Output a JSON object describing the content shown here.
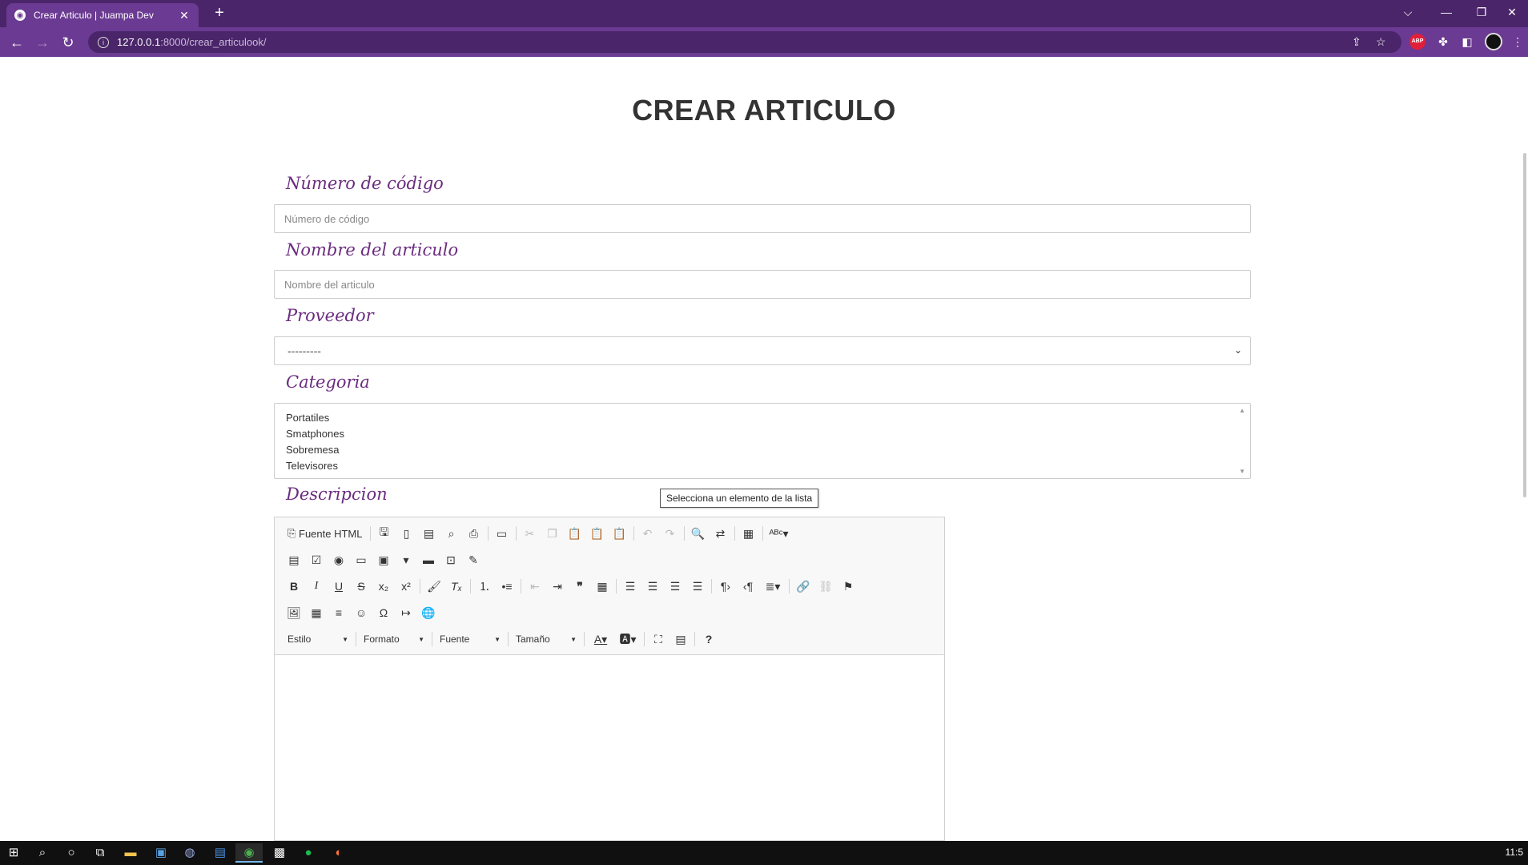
{
  "browser": {
    "tab_title": "Crear Articulo | Juampa Dev",
    "tab_close": "✕",
    "new_tab": "+",
    "url_host": "127.0.0.1",
    "url_path": ":8000/crear_articulook/",
    "window_controls": [
      "⌵",
      "—",
      "❐",
      "✕"
    ],
    "extensions": [
      "share-icon",
      "star-icon",
      "adblock-icon",
      "puzzle-icon",
      "sidepanel-icon",
      "avatar",
      "kebab-icon"
    ],
    "abp_label": "ABP"
  },
  "page": {
    "title": "CREAR ARTICULO",
    "fields": {
      "codigo_label": "Número de código",
      "codigo_placeholder": "Número de código",
      "nombre_label": "Nombre del articulo",
      "nombre_placeholder": "Nombre del articulo",
      "proveedor_label": "Proveedor",
      "proveedor_value": "---------",
      "categoria_label": "Categoria",
      "categoria_options": [
        "Portatiles",
        "Smatphones",
        "Sobremesa",
        "Televisores"
      ],
      "descripcion_label": "Descripcion"
    },
    "tooltip": "Selecciona un elemento de la lista"
  },
  "editor": {
    "source_label": "Fuente HTML",
    "combos": [
      "Estilo",
      "Formato",
      "Fuente",
      "Tamaño"
    ],
    "help": "?"
  },
  "taskbar": {
    "clock": "11:5"
  }
}
